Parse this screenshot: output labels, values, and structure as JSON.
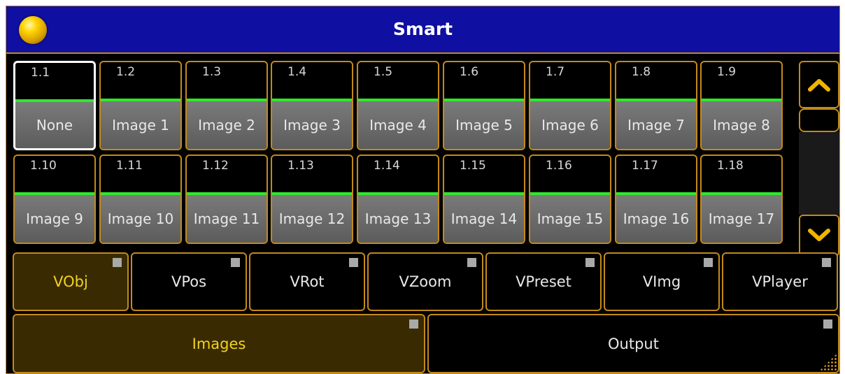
{
  "window": {
    "title": "Smart"
  },
  "tiles": [
    {
      "num": "1.1",
      "label": "None"
    },
    {
      "num": "1.2",
      "label": "Image 1"
    },
    {
      "num": "1.3",
      "label": "Image 2"
    },
    {
      "num": "1.4",
      "label": "Image 3"
    },
    {
      "num": "1.5",
      "label": "Image 4"
    },
    {
      "num": "1.6",
      "label": "Image 5"
    },
    {
      "num": "1.7",
      "label": "Image 6"
    },
    {
      "num": "1.8",
      "label": "Image 7"
    },
    {
      "num": "1.9",
      "label": "Image 8"
    },
    {
      "num": "1.10",
      "label": "Image 9"
    },
    {
      "num": "1.11",
      "label": "Image 10"
    },
    {
      "num": "1.12",
      "label": "Image 11"
    },
    {
      "num": "1.13",
      "label": "Image 12"
    },
    {
      "num": "1.14",
      "label": "Image 13"
    },
    {
      "num": "1.15",
      "label": "Image 14"
    },
    {
      "num": "1.16",
      "label": "Image 15"
    },
    {
      "num": "1.17",
      "label": "Image 16"
    },
    {
      "num": "1.18",
      "label": "Image 17"
    }
  ],
  "selected_tile": "1.1",
  "scroll": {
    "up_icon": "chevron-up-icon",
    "down_icon": "chevron-down-icon"
  },
  "filter_tabs": [
    {
      "label": "VObj",
      "active": true
    },
    {
      "label": "VPos",
      "active": false
    },
    {
      "label": "VRot",
      "active": false
    },
    {
      "label": "VZoom",
      "active": false
    },
    {
      "label": "VPreset",
      "active": false
    },
    {
      "label": "VImg",
      "active": false
    },
    {
      "label": "VPlayer",
      "active": false
    }
  ],
  "bottom_tabs": [
    {
      "label": "Images",
      "active": true
    },
    {
      "label": "Output",
      "active": false
    }
  ],
  "colors": {
    "titlebar": "#0f0fa2",
    "border": "#c38a1a",
    "status_bar": "#2ee82e",
    "active_bg": "#3a2a02",
    "active_text": "#f0d420"
  }
}
